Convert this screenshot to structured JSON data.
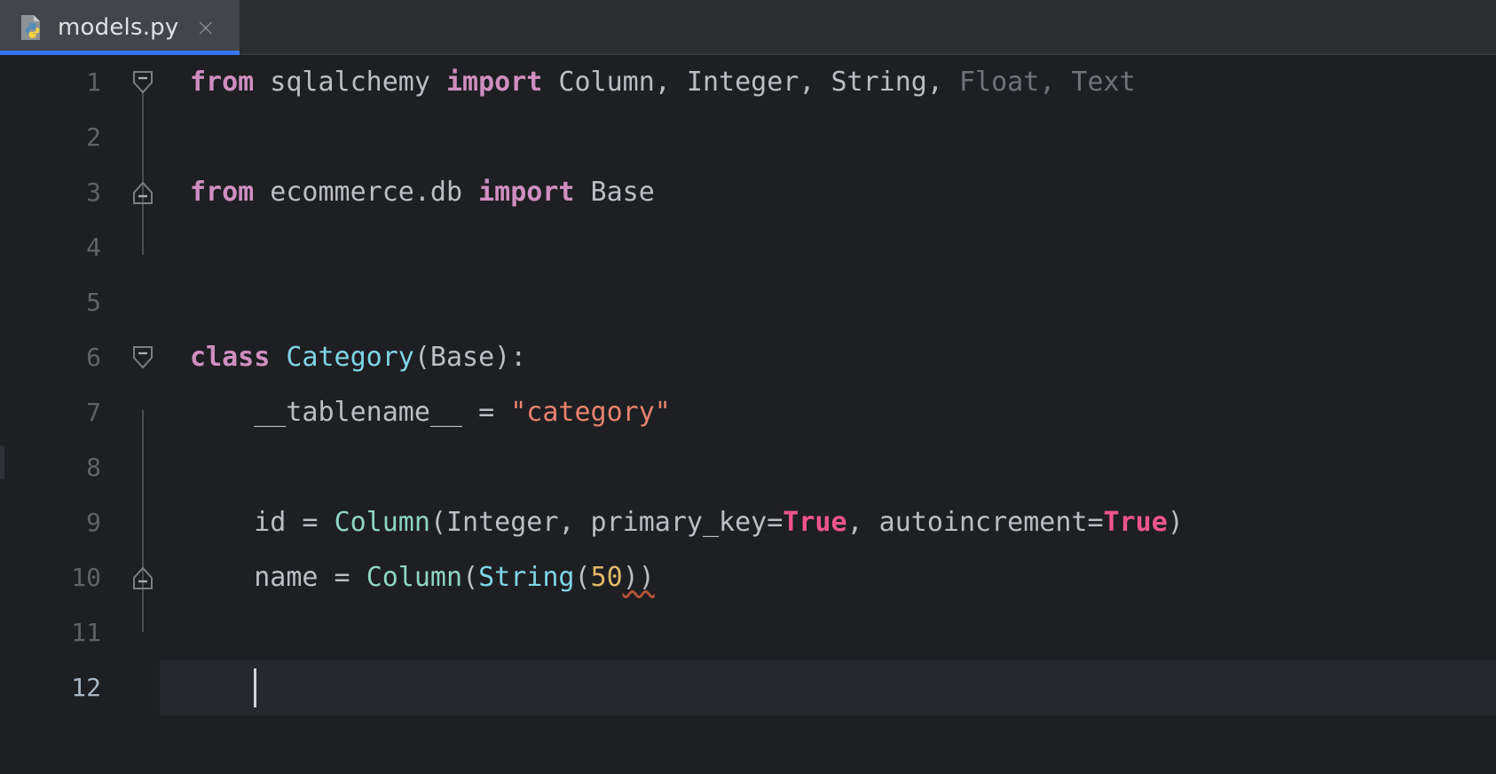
{
  "window": {
    "background": "#1e1f22",
    "accent": "#3574f0"
  },
  "tabbar": {
    "tabs": [
      {
        "label": "models.py",
        "icon": "python-file-icon",
        "close_label": "×",
        "active": true
      }
    ]
  },
  "editor": {
    "language": "python",
    "caret": {
      "line": 12,
      "column": 5
    },
    "lines": [
      {
        "number": "1",
        "fold": "open",
        "tokens": [
          {
            "text": "from",
            "type": "keyword"
          },
          {
            "text": " sqlalchemy ",
            "type": "plain"
          },
          {
            "text": "import",
            "type": "keyword"
          },
          {
            "text": " Column, Integer, String, ",
            "type": "plain"
          },
          {
            "text": "Float, Text",
            "type": "unused"
          }
        ]
      },
      {
        "number": "2",
        "fold": "none",
        "tokens": []
      },
      {
        "number": "3",
        "fold": "close",
        "tokens": [
          {
            "text": "from",
            "type": "keyword"
          },
          {
            "text": " ecommerce.db ",
            "type": "plain"
          },
          {
            "text": "import",
            "type": "keyword"
          },
          {
            "text": " Base",
            "type": "plain"
          }
        ]
      },
      {
        "number": "4",
        "fold": "none",
        "tokens": []
      },
      {
        "number": "5",
        "fold": "none",
        "tokens": []
      },
      {
        "number": "6",
        "fold": "open",
        "tokens": [
          {
            "text": "class",
            "type": "keyword"
          },
          {
            "text": " ",
            "type": "plain"
          },
          {
            "text": "Category",
            "type": "class"
          },
          {
            "text": "(Base):",
            "type": "plain"
          }
        ]
      },
      {
        "number": "7",
        "fold": "none",
        "tokens": [
          {
            "text": "    __tablename__ = ",
            "type": "plain"
          },
          {
            "text": "\"category\"",
            "type": "string"
          }
        ]
      },
      {
        "number": "8",
        "fold": "none",
        "tokens": []
      },
      {
        "number": "9",
        "fold": "none",
        "tokens": [
          {
            "text": "    id = ",
            "type": "plain"
          },
          {
            "text": "Column",
            "type": "function"
          },
          {
            "text": "(Integer, primary_key=",
            "type": "plain"
          },
          {
            "text": "True",
            "type": "boolean"
          },
          {
            "text": ", autoincrement=",
            "type": "plain"
          },
          {
            "text": "True",
            "type": "boolean"
          },
          {
            "text": ")",
            "type": "plain"
          }
        ]
      },
      {
        "number": "10",
        "fold": "close",
        "tokens": [
          {
            "text": "    name = ",
            "type": "plain"
          },
          {
            "text": "Column",
            "type": "function"
          },
          {
            "text": "(",
            "type": "plain"
          },
          {
            "text": "String",
            "type": "class"
          },
          {
            "text": "(",
            "type": "plain"
          },
          {
            "text": "50",
            "type": "number"
          },
          {
            "text": "))",
            "type": "error"
          }
        ]
      },
      {
        "number": "11",
        "fold": "none",
        "tokens": []
      },
      {
        "number": "12",
        "fold": "none",
        "caret": true,
        "tokens": []
      }
    ]
  }
}
